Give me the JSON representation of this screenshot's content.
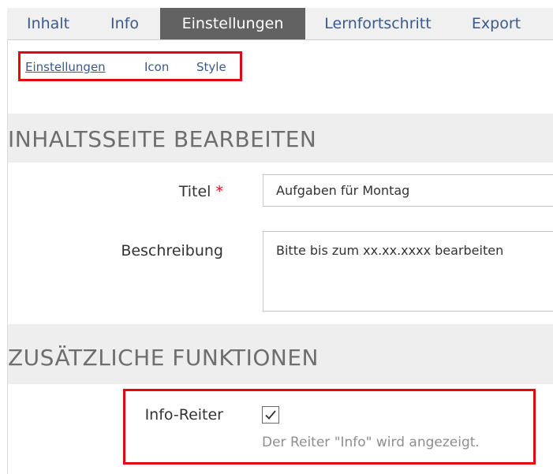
{
  "tabs": [
    {
      "label": "Inhalt",
      "active": false
    },
    {
      "label": "Info",
      "active": false
    },
    {
      "label": "Einstellungen",
      "active": true
    },
    {
      "label": "Lernfortschritt",
      "active": false
    },
    {
      "label": "Export",
      "active": false
    }
  ],
  "subtabs": [
    {
      "label": "Einstellungen",
      "selected": true
    },
    {
      "label": "Icon",
      "selected": false
    },
    {
      "label": "Style",
      "selected": false
    }
  ],
  "sections": {
    "edit_title": "INHALTSSEITE BEARBEITEN",
    "extra_title": "ZUSÄTZLICHE FUNKTIONEN"
  },
  "form": {
    "title_label": "Titel",
    "required_mark": "*",
    "title_value": "Aufgaben für Montag",
    "description_label": "Beschreibung",
    "description_value": "Bitte bis zum xx.xx.xxxx bearbeiten",
    "info_tab_label": "Info-Reiter",
    "info_tab_checked": true,
    "info_tab_hint": "Der Reiter \"Info\" wird angezeigt."
  },
  "colors": {
    "active_tab_bg": "#626262",
    "link": "#3a5a8c",
    "highlight_border": "#e30613",
    "section_bg": "#eeeeee"
  },
  "icons": {
    "checkbox_mark": "check-icon"
  }
}
